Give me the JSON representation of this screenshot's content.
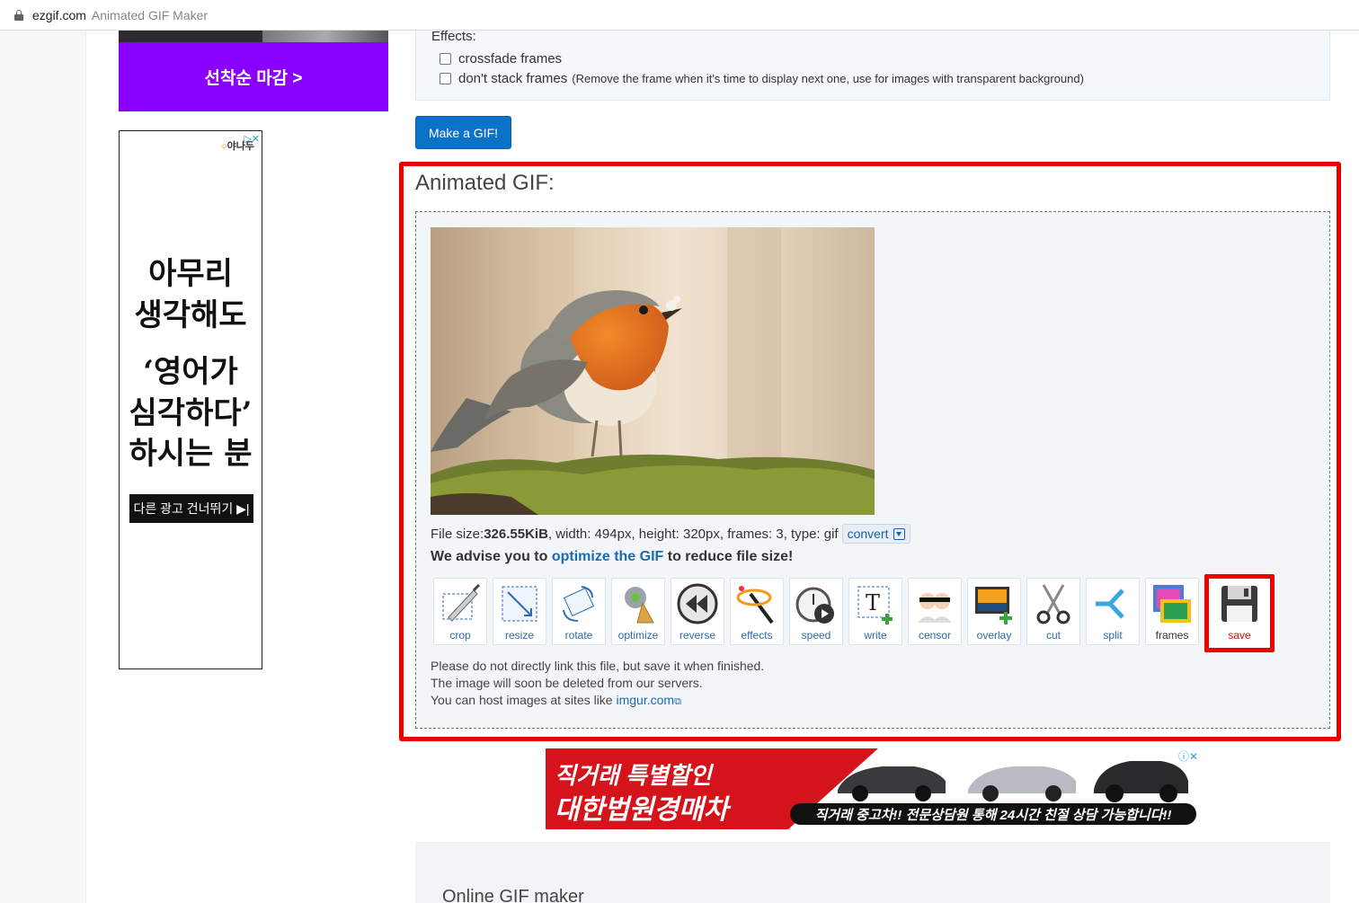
{
  "browser": {
    "domain": "ezgif.com",
    "page_title": "Animated GIF Maker"
  },
  "ads": {
    "purple_cta": "선착순 마감 >",
    "tall_brand_a": "야나",
    "tall_brand_b": "두",
    "tall_ad_x": "▷✕",
    "tall_lines": [
      "아무리",
      "생각해도",
      "‘영어가",
      "심각하다’",
      "하시는 분"
    ],
    "tall_skip": "다른 광고 건너뛰기 ▶|",
    "car_line1": "직거래 특별할인",
    "car_line2": "대한법원경매차",
    "car_bar": "직거래 중고차!! 전문상담원 통해 24시간 친절 상담 가능합니다!!",
    "car_ix": "ⓘ✕"
  },
  "effects": {
    "label": "Effects:",
    "crossfade": "crossfade frames",
    "dont_stack": "don't stack frames",
    "dont_stack_note": "(Remove the frame when it's time to display next one, use for images with transparent background)"
  },
  "make_button": "Make a GIF!",
  "result": {
    "title": "Animated GIF:",
    "file_size_label": "File size: ",
    "file_size": "326.55KiB",
    "details": ", width: 494px, height: 320px, frames: 3, type: gif",
    "convert": "convert",
    "advise_pre": "We advise you to ",
    "advise_link": "optimize the GIF",
    "advise_post": " to reduce file size!",
    "tools": [
      {
        "label": "crop",
        "icon": "crop-icon"
      },
      {
        "label": "resize",
        "icon": "resize-icon"
      },
      {
        "label": "rotate",
        "icon": "rotate-icon"
      },
      {
        "label": "optimize",
        "icon": "broom-icon"
      },
      {
        "label": "reverse",
        "icon": "rewind-icon"
      },
      {
        "label": "effects",
        "icon": "magic-wand-icon"
      },
      {
        "label": "speed",
        "icon": "stopwatch-icon"
      },
      {
        "label": "write",
        "icon": "text-icon"
      },
      {
        "label": "censor",
        "icon": "censor-icon"
      },
      {
        "label": "overlay",
        "icon": "image-add-icon"
      },
      {
        "label": "cut",
        "icon": "scissors-icon"
      },
      {
        "label": "split",
        "icon": "split-icon"
      },
      {
        "label": "frames",
        "icon": "frames-icon"
      },
      {
        "label": "save",
        "icon": "floppy-disk-icon"
      }
    ],
    "note1": "Please do not directly link this file, but save it when finished.",
    "note2": "The image will soon be deleted from our servers.",
    "note3_pre": "You can host images at sites like ",
    "note3_link": "imgur.com"
  },
  "next_section_title": "Online GIF maker",
  "colors": {
    "accent_blue": "#0a72c9",
    "highlight_red": "#ee0000",
    "link": "#1a6bb0"
  }
}
